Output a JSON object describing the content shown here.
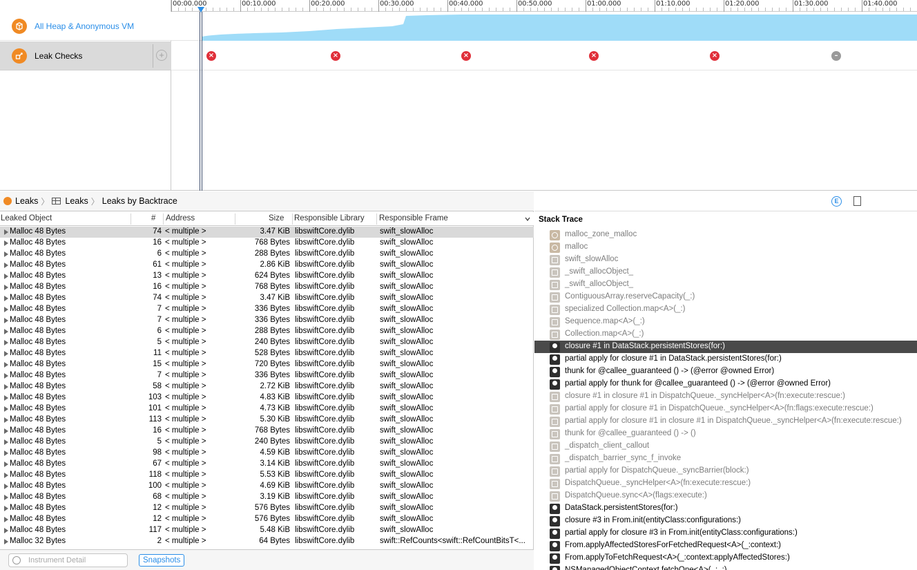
{
  "tracks": {
    "heap_label": "All Heap & Anonymous VM",
    "leaks_label": "Leak Checks",
    "add_symbol": "+"
  },
  "ruler": {
    "labels": [
      "00:00.000",
      "00:10.000",
      "00:20.000",
      "00:30.000",
      "00:40.000",
      "00:50.000",
      "01:00.000",
      "01:10.000",
      "01:20.000",
      "01:30.000",
      "01:40.000"
    ]
  },
  "leak_marks": [
    {
      "symbol": "×",
      "status": "leak"
    },
    {
      "symbol": "×",
      "status": "leak"
    },
    {
      "symbol": "×",
      "status": "leak"
    },
    {
      "symbol": "×",
      "status": "leak"
    },
    {
      "symbol": "×",
      "status": "leak"
    },
    {
      "symbol": "–",
      "status": "none"
    }
  ],
  "breadcrumb": {
    "item1": "Leaks",
    "item2": "Leaks",
    "item3": "Leaks by Backtrace",
    "separator": "〉"
  },
  "table": {
    "columns": {
      "object": "Leaked Object",
      "count": "#",
      "address": "Address",
      "size": "Size",
      "library": "Responsible Library",
      "frame": "Responsible Frame"
    },
    "rows": [
      {
        "object": "Malloc 48 Bytes",
        "count": "74",
        "address": "< multiple >",
        "size": "3.47 KiB",
        "library": "libswiftCore.dylib",
        "frame": "swift_slowAlloc"
      },
      {
        "object": "Malloc 48 Bytes",
        "count": "16",
        "address": "< multiple >",
        "size": "768 Bytes",
        "library": "libswiftCore.dylib",
        "frame": "swift_slowAlloc"
      },
      {
        "object": "Malloc 48 Bytes",
        "count": "6",
        "address": "< multiple >",
        "size": "288 Bytes",
        "library": "libswiftCore.dylib",
        "frame": "swift_slowAlloc"
      },
      {
        "object": "Malloc 48 Bytes",
        "count": "61",
        "address": "< multiple >",
        "size": "2.86 KiB",
        "library": "libswiftCore.dylib",
        "frame": "swift_slowAlloc"
      },
      {
        "object": "Malloc 48 Bytes",
        "count": "13",
        "address": "< multiple >",
        "size": "624 Bytes",
        "library": "libswiftCore.dylib",
        "frame": "swift_slowAlloc"
      },
      {
        "object": "Malloc 48 Bytes",
        "count": "16",
        "address": "< multiple >",
        "size": "768 Bytes",
        "library": "libswiftCore.dylib",
        "frame": "swift_slowAlloc"
      },
      {
        "object": "Malloc 48 Bytes",
        "count": "74",
        "address": "< multiple >",
        "size": "3.47 KiB",
        "library": "libswiftCore.dylib",
        "frame": "swift_slowAlloc"
      },
      {
        "object": "Malloc 48 Bytes",
        "count": "7",
        "address": "< multiple >",
        "size": "336 Bytes",
        "library": "libswiftCore.dylib",
        "frame": "swift_slowAlloc"
      },
      {
        "object": "Malloc 48 Bytes",
        "count": "7",
        "address": "< multiple >",
        "size": "336 Bytes",
        "library": "libswiftCore.dylib",
        "frame": "swift_slowAlloc"
      },
      {
        "object": "Malloc 48 Bytes",
        "count": "6",
        "address": "< multiple >",
        "size": "288 Bytes",
        "library": "libswiftCore.dylib",
        "frame": "swift_slowAlloc"
      },
      {
        "object": "Malloc 48 Bytes",
        "count": "5",
        "address": "< multiple >",
        "size": "240 Bytes",
        "library": "libswiftCore.dylib",
        "frame": "swift_slowAlloc"
      },
      {
        "object": "Malloc 48 Bytes",
        "count": "11",
        "address": "< multiple >",
        "size": "528 Bytes",
        "library": "libswiftCore.dylib",
        "frame": "swift_slowAlloc"
      },
      {
        "object": "Malloc 48 Bytes",
        "count": "15",
        "address": "< multiple >",
        "size": "720 Bytes",
        "library": "libswiftCore.dylib",
        "frame": "swift_slowAlloc"
      },
      {
        "object": "Malloc 48 Bytes",
        "count": "7",
        "address": "< multiple >",
        "size": "336 Bytes",
        "library": "libswiftCore.dylib",
        "frame": "swift_slowAlloc"
      },
      {
        "object": "Malloc 48 Bytes",
        "count": "58",
        "address": "< multiple >",
        "size": "2.72 KiB",
        "library": "libswiftCore.dylib",
        "frame": "swift_slowAlloc"
      },
      {
        "object": "Malloc 48 Bytes",
        "count": "103",
        "address": "< multiple >",
        "size": "4.83 KiB",
        "library": "libswiftCore.dylib",
        "frame": "swift_slowAlloc"
      },
      {
        "object": "Malloc 48 Bytes",
        "count": "101",
        "address": "< multiple >",
        "size": "4.73 KiB",
        "library": "libswiftCore.dylib",
        "frame": "swift_slowAlloc"
      },
      {
        "object": "Malloc 48 Bytes",
        "count": "113",
        "address": "< multiple >",
        "size": "5.30 KiB",
        "library": "libswiftCore.dylib",
        "frame": "swift_slowAlloc"
      },
      {
        "object": "Malloc 48 Bytes",
        "count": "16",
        "address": "< multiple >",
        "size": "768 Bytes",
        "library": "libswiftCore.dylib",
        "frame": "swift_slowAlloc"
      },
      {
        "object": "Malloc 48 Bytes",
        "count": "5",
        "address": "< multiple >",
        "size": "240 Bytes",
        "library": "libswiftCore.dylib",
        "frame": "swift_slowAlloc"
      },
      {
        "object": "Malloc 48 Bytes",
        "count": "98",
        "address": "< multiple >",
        "size": "4.59 KiB",
        "library": "libswiftCore.dylib",
        "frame": "swift_slowAlloc"
      },
      {
        "object": "Malloc 48 Bytes",
        "count": "67",
        "address": "< multiple >",
        "size": "3.14 KiB",
        "library": "libswiftCore.dylib",
        "frame": "swift_slowAlloc"
      },
      {
        "object": "Malloc 48 Bytes",
        "count": "118",
        "address": "< multiple >",
        "size": "5.53 KiB",
        "library": "libswiftCore.dylib",
        "frame": "swift_slowAlloc"
      },
      {
        "object": "Malloc 48 Bytes",
        "count": "100",
        "address": "< multiple >",
        "size": "4.69 KiB",
        "library": "libswiftCore.dylib",
        "frame": "swift_slowAlloc"
      },
      {
        "object": "Malloc 48 Bytes",
        "count": "68",
        "address": "< multiple >",
        "size": "3.19 KiB",
        "library": "libswiftCore.dylib",
        "frame": "swift_slowAlloc"
      },
      {
        "object": "Malloc 48 Bytes",
        "count": "12",
        "address": "< multiple >",
        "size": "576 Bytes",
        "library": "libswiftCore.dylib",
        "frame": "swift_slowAlloc"
      },
      {
        "object": "Malloc 48 Bytes",
        "count": "12",
        "address": "< multiple >",
        "size": "576 Bytes",
        "library": "libswiftCore.dylib",
        "frame": "swift_slowAlloc"
      },
      {
        "object": "Malloc 48 Bytes",
        "count": "117",
        "address": "< multiple >",
        "size": "5.48 KiB",
        "library": "libswiftCore.dylib",
        "frame": "swift_slowAlloc"
      },
      {
        "object": "Malloc 32 Bytes",
        "count": "2",
        "address": "< multiple >",
        "size": "64 Bytes",
        "library": "libswiftCore.dylib",
        "frame": "swift::RefCounts<swift::RefCountBitsT<..."
      }
    ]
  },
  "bottombar": {
    "filter_placeholder": "Instrument Detail",
    "snapshots_label": "Snapshots"
  },
  "inspector": {
    "ext_symbol": "E",
    "stack_title": "Stack Trace",
    "frames": [
      {
        "text": "malloc_zone_malloc",
        "kind": "sys",
        "dim": true
      },
      {
        "text": "malloc",
        "kind": "sys",
        "dim": true
      },
      {
        "text": "swift_slowAlloc",
        "kind": "lib",
        "dim": true
      },
      {
        "text": "_swift_allocObject_",
        "kind": "lib",
        "dim": true
      },
      {
        "text": "_swift_allocObject_",
        "kind": "lib",
        "dim": true
      },
      {
        "text": "ContiguousArray.reserveCapacity(_:)",
        "kind": "lib",
        "dim": true
      },
      {
        "text": "specialized Collection.map<A>(_:)",
        "kind": "lib",
        "dim": true
      },
      {
        "text": "Sequence.map<A>(_:)",
        "kind": "lib",
        "dim": true
      },
      {
        "text": "Collection.map<A>(_:)",
        "kind": "lib",
        "dim": true
      },
      {
        "text": "closure #1 in DataStack.persistentStores(for:)",
        "kind": "user",
        "dim": false,
        "selected": true
      },
      {
        "text": "partial apply for closure #1 in DataStack.persistentStores(for:)",
        "kind": "user",
        "dim": false
      },
      {
        "text": "thunk for @callee_guaranteed () -> (@error @owned Error)",
        "kind": "user",
        "dim": false
      },
      {
        "text": "partial apply for thunk for @callee_guaranteed () -> (@error @owned Error)",
        "kind": "user",
        "dim": false
      },
      {
        "text": "closure #1 in closure #1 in DispatchQueue._syncHelper<A>(fn:execute:rescue:)",
        "kind": "lib",
        "dim": true
      },
      {
        "text": "partial apply for closure #1 in DispatchQueue._syncHelper<A>(fn:flags:execute:rescue:)",
        "kind": "lib",
        "dim": true
      },
      {
        "text": "partial apply for closure #1 in closure #1 in DispatchQueue._syncHelper<A>(fn:execute:rescue:)",
        "kind": "lib",
        "dim": true
      },
      {
        "text": "thunk for @callee_guaranteed () -> ()",
        "kind": "lib",
        "dim": true
      },
      {
        "text": "_dispatch_client_callout",
        "kind": "lib",
        "dim": true
      },
      {
        "text": "_dispatch_barrier_sync_f_invoke",
        "kind": "lib",
        "dim": true
      },
      {
        "text": "partial apply for DispatchQueue._syncBarrier(block:)",
        "kind": "lib",
        "dim": true
      },
      {
        "text": "DispatchQueue._syncHelper<A>(fn:execute:rescue:)",
        "kind": "lib",
        "dim": true
      },
      {
        "text": "DispatchQueue.sync<A>(flags:execute:)",
        "kind": "lib",
        "dim": true
      },
      {
        "text": "DataStack.persistentStores(for:)",
        "kind": "user",
        "dim": false
      },
      {
        "text": "closure #3 in From.init(entityClass:configurations:)",
        "kind": "user",
        "dim": false
      },
      {
        "text": "partial apply for closure #3 in From.init(entityClass:configurations:)",
        "kind": "user",
        "dim": false
      },
      {
        "text": "From.applyAffectedStoresForFetchedRequest<A>(_:context:)",
        "kind": "user",
        "dim": false
      },
      {
        "text": "From.applyToFetchRequest<A>(_:context:applyAffectedStores:)",
        "kind": "user",
        "dim": false
      },
      {
        "text": "NSManagedObjectContext.fetchOne<A>(_:_:)",
        "kind": "user",
        "dim": false
      }
    ]
  },
  "colors": {
    "accent": "#2a8ee8",
    "instrument_orange": "#f08a24",
    "heap_fill": "#9fdcf8",
    "leak_red": "#e0303a",
    "selection_dark": "#4a4a4a"
  }
}
